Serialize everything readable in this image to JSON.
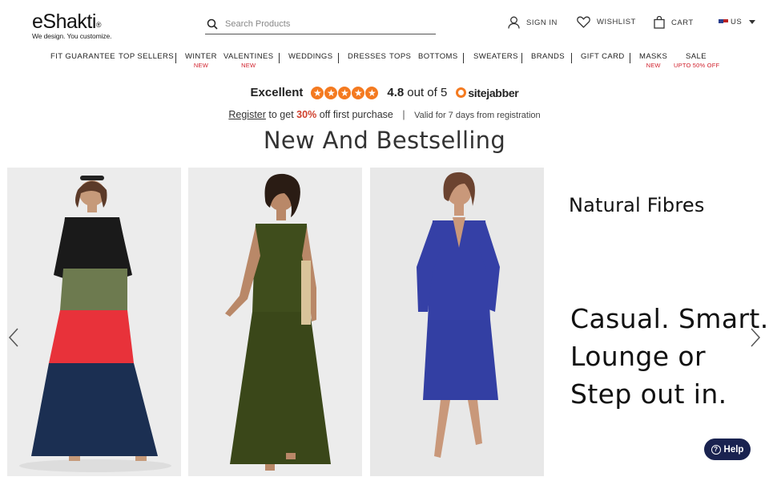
{
  "brand": {
    "name": "eShakti",
    "tagline": "We design. You customize."
  },
  "search": {
    "placeholder": "Search Products"
  },
  "utility": {
    "signin": "SIGN IN",
    "wishlist": "WISHLIST",
    "cart": "CART",
    "country": "US"
  },
  "nav": [
    {
      "label": "FIT GUARANTEE",
      "sub": ""
    },
    {
      "label": "TOP SELLERS",
      "sub": ""
    },
    {
      "label": "WINTER",
      "sub": "NEW"
    },
    {
      "label": "VALENTINES",
      "sub": "NEW"
    },
    {
      "label": "WEDDINGS",
      "sub": ""
    },
    {
      "label": "DRESSES",
      "sub": ""
    },
    {
      "label": "TOPS",
      "sub": ""
    },
    {
      "label": "BOTTOMS",
      "sub": ""
    },
    {
      "label": "SWEATERS",
      "sub": ""
    },
    {
      "label": "BRANDS",
      "sub": ""
    },
    {
      "label": "GIFT CARD",
      "sub": ""
    },
    {
      "label": "MASKS",
      "sub": "NEW"
    },
    {
      "label": "SALE",
      "sub": "UPTO 50% OFF"
    }
  ],
  "rating": {
    "label": "Excellent",
    "score": "4.8",
    "out_of": "out of 5",
    "source": "sitejabber",
    "stars": 5
  },
  "promo": {
    "register": "Register",
    "to_get": "to get",
    "percent": "30%",
    "rest": "off first purchase",
    "valid": "Valid for 7 days from registration"
  },
  "section_title": "New And Bestselling",
  "banner": {
    "title": "Natural Fibres",
    "lines": [
      "Casual. Smart.",
      "Lounge or",
      "Step out in."
    ]
  },
  "help": {
    "label": "Help"
  },
  "colors": {
    "accent": "#f47a20",
    "sale_red": "#d0202c",
    "help_bg": "#1a2350"
  }
}
